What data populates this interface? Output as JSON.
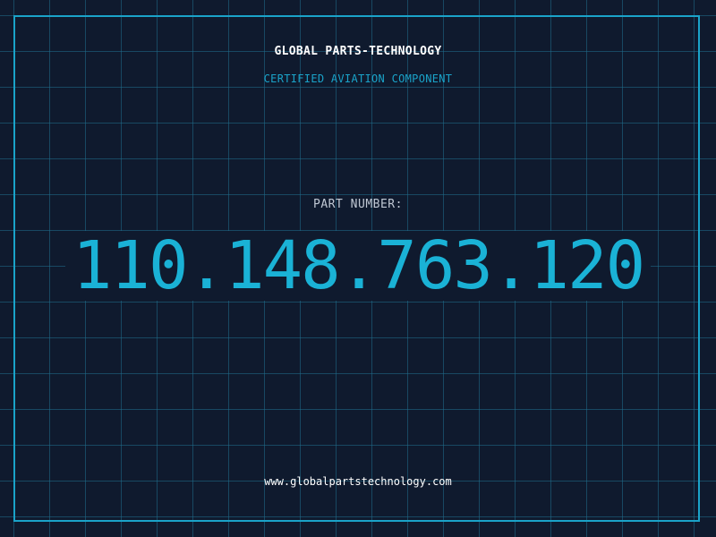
{
  "header": {
    "company": "GLOBAL PARTS-TECHNOLOGY",
    "tagline": "CERTIFIED AVIATION COMPONENT"
  },
  "part": {
    "label": "PART NUMBER:",
    "number": "110.148.763.120"
  },
  "footer": {
    "website": "www.globalpartstechnology.com"
  },
  "colors": {
    "background": "#0f1a2e",
    "grid": "#1f6e8c",
    "accent": "#1ab2d6",
    "frame": "#1aa3c9",
    "label": "#c0c8d4",
    "text": "#ffffff"
  }
}
